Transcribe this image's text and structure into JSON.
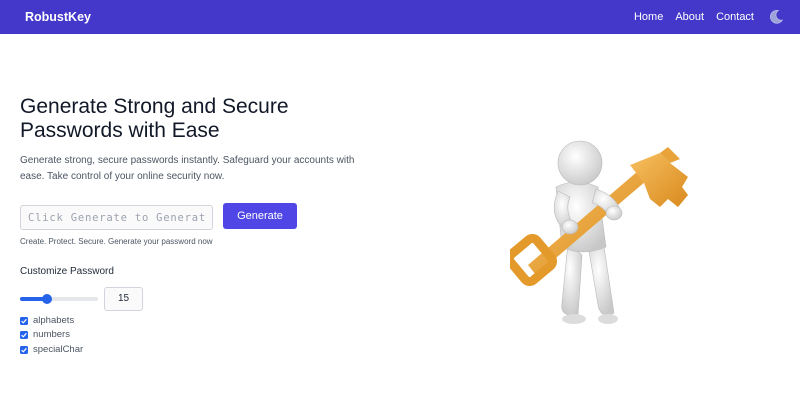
{
  "header": {
    "brand": "RobustKey",
    "nav": [
      {
        "label": "Home"
      },
      {
        "label": "About"
      },
      {
        "label": "Contact"
      }
    ],
    "theme_icon": "moon-icon"
  },
  "hero": {
    "title": "Generate Strong and Secure Passwords with Ease",
    "description": "Generate strong, secure passwords instantly. Safeguard your accounts with ease. Take control of your online security now."
  },
  "generator": {
    "placeholder": "Click Generate to Generate Password",
    "value": "",
    "button_label": "Generate",
    "tagline": "Create. Protect. Secure. Generate your password now"
  },
  "customize": {
    "label": "Customize Password",
    "length_value": "15",
    "slider_fraction": 0.35,
    "options": [
      {
        "label": "alphabets",
        "checked": true
      },
      {
        "label": "numbers",
        "checked": true
      },
      {
        "label": "specialChar",
        "checked": true
      }
    ]
  },
  "colors": {
    "navbar": "#4338ca",
    "button": "#4f46e5",
    "accent": "#2563eb",
    "key": "#f0a030"
  },
  "illustration": {
    "icon": "person-holding-key-illustration"
  }
}
